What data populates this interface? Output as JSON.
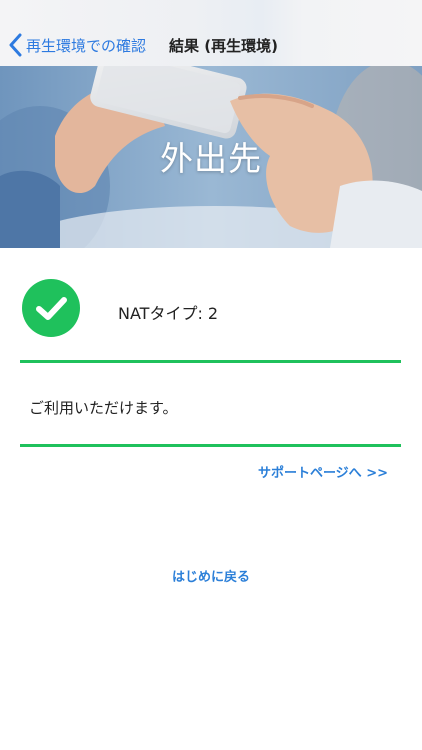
{
  "nav": {
    "back_label": "再生環境での確認",
    "title": "結果 (再生環境)"
  },
  "hero": {
    "title": "外出先"
  },
  "result": {
    "nat_label": "NATタイプ: 2",
    "message": "ご利用いただけます。",
    "status_icon": "checkmark-icon",
    "status_color": "#1fc15c"
  },
  "links": {
    "support": "サポートページへ >>",
    "home": "はじめに戻る"
  },
  "colors": {
    "accent": "#2b7fd8",
    "success": "#1fc15c"
  }
}
